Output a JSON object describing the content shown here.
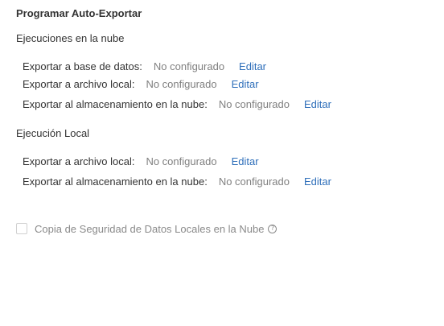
{
  "title": "Programar Auto-Exportar",
  "cloud_section": {
    "heading": "Ejecuciones en la nube",
    "rows": [
      {
        "label": "Exportar a base de datos:",
        "value": "No configurado",
        "action": "Editar"
      },
      {
        "label": "Exportar a archivo local:",
        "value": "No configurado",
        "action": "Editar"
      },
      {
        "label": "Exportar al almacenamiento en la nube:",
        "value": "No configurado",
        "action": "Editar"
      }
    ]
  },
  "local_section": {
    "heading": "Ejecución Local",
    "rows": [
      {
        "label": "Exportar a archivo local:",
        "value": "No configurado",
        "action": "Editar"
      },
      {
        "label": "Exportar al almacenamiento en la nube:",
        "value": "No configurado",
        "action": "Editar"
      }
    ]
  },
  "backup": {
    "label": "Copia de Seguridad de Datos Locales en la Nube",
    "checked": false,
    "help_icon": "question-circle-icon"
  },
  "colors": {
    "link": "#2f6fba",
    "muted": "#808080",
    "text": "#333333"
  }
}
